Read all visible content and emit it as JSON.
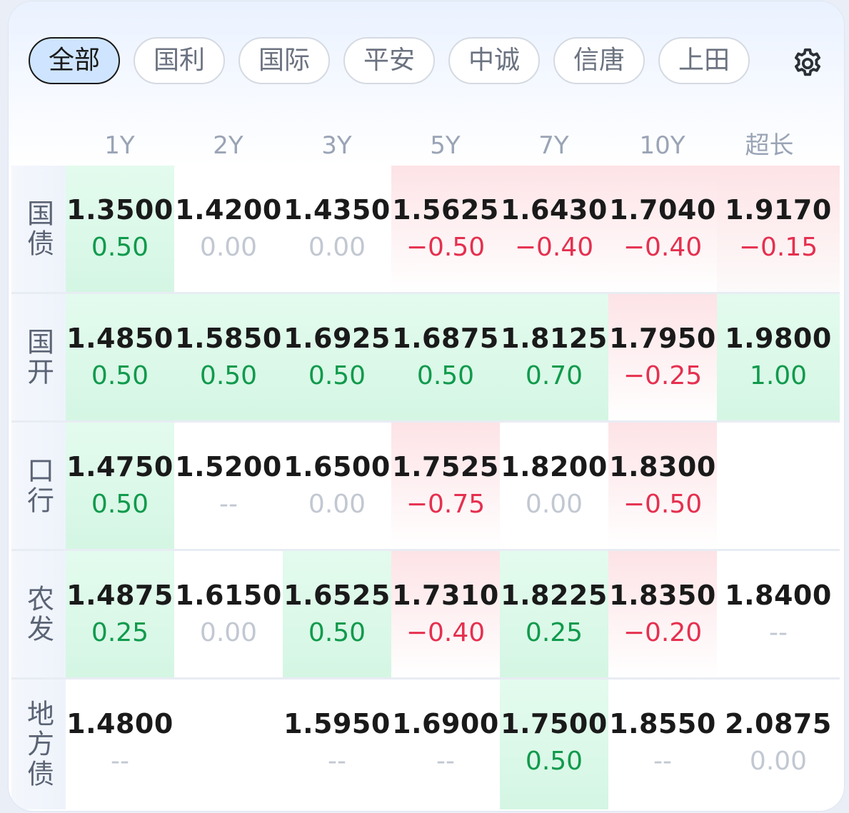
{
  "tabs": [
    "全部",
    "国利",
    "国际",
    "平安",
    "中诚",
    "信唐",
    "上田"
  ],
  "active_tab": "全部",
  "settings_icon": "gear-icon",
  "columns": [
    "1Y",
    "2Y",
    "3Y",
    "5Y",
    "7Y",
    "10Y",
    "超长"
  ],
  "colors": {
    "up": "#109a4c",
    "down": "#e5304f",
    "flat": "#c2c8d2",
    "active_tab_bg": "#cfe5ff"
  },
  "rows": [
    {
      "label": "国债",
      "cells": [
        {
          "value": "1.3500",
          "change": "0.50",
          "trend": "up"
        },
        {
          "value": "1.4200",
          "change": "0.00",
          "trend": "flat"
        },
        {
          "value": "1.4350",
          "change": "0.00",
          "trend": "flat"
        },
        {
          "value": "1.5625",
          "change": "−0.50",
          "trend": "down"
        },
        {
          "value": "1.6430",
          "change": "−0.40",
          "trend": "down"
        },
        {
          "value": "1.7040",
          "change": "−0.40",
          "trend": "down"
        },
        {
          "value": "1.9170",
          "change": "−0.15",
          "trend": "down"
        }
      ]
    },
    {
      "label": "国开",
      "cells": [
        {
          "value": "1.4850",
          "change": "0.50",
          "trend": "up"
        },
        {
          "value": "1.5850",
          "change": "0.50",
          "trend": "up"
        },
        {
          "value": "1.6925",
          "change": "0.50",
          "trend": "up"
        },
        {
          "value": "1.6875",
          "change": "0.50",
          "trend": "up"
        },
        {
          "value": "1.8125",
          "change": "0.70",
          "trend": "up"
        },
        {
          "value": "1.7950",
          "change": "−0.25",
          "trend": "down"
        },
        {
          "value": "1.9800",
          "change": "1.00",
          "trend": "up"
        }
      ]
    },
    {
      "label": "口行",
      "cells": [
        {
          "value": "1.4750",
          "change": "0.50",
          "trend": "up"
        },
        {
          "value": "1.5200",
          "change": "--",
          "trend": "none"
        },
        {
          "value": "1.6500",
          "change": "0.00",
          "trend": "flat"
        },
        {
          "value": "1.7525",
          "change": "−0.75",
          "trend": "down"
        },
        {
          "value": "1.8200",
          "change": "0.00",
          "trend": "flat"
        },
        {
          "value": "1.8300",
          "change": "−0.50",
          "trend": "down"
        },
        {
          "value": "",
          "change": "",
          "trend": "none"
        }
      ]
    },
    {
      "label": "农发",
      "cells": [
        {
          "value": "1.4875",
          "change": "0.25",
          "trend": "up"
        },
        {
          "value": "1.6150",
          "change": "0.00",
          "trend": "flat"
        },
        {
          "value": "1.6525",
          "change": "0.50",
          "trend": "up"
        },
        {
          "value": "1.7310",
          "change": "−0.40",
          "trend": "down"
        },
        {
          "value": "1.8225",
          "change": "0.25",
          "trend": "up"
        },
        {
          "value": "1.8350",
          "change": "−0.20",
          "trend": "down"
        },
        {
          "value": "1.8400",
          "change": "--",
          "trend": "none"
        }
      ]
    },
    {
      "label": "地方债",
      "cells": [
        {
          "value": "1.4800",
          "change": "--",
          "trend": "none"
        },
        {
          "value": "",
          "change": "",
          "trend": "none"
        },
        {
          "value": "1.5950",
          "change": "--",
          "trend": "none"
        },
        {
          "value": "1.6900",
          "change": "--",
          "trend": "none"
        },
        {
          "value": "1.7500",
          "change": "0.50",
          "trend": "up"
        },
        {
          "value": "1.8550",
          "change": "--",
          "trend": "none"
        },
        {
          "value": "2.0875",
          "change": "0.00",
          "trend": "flat"
        }
      ]
    }
  ]
}
